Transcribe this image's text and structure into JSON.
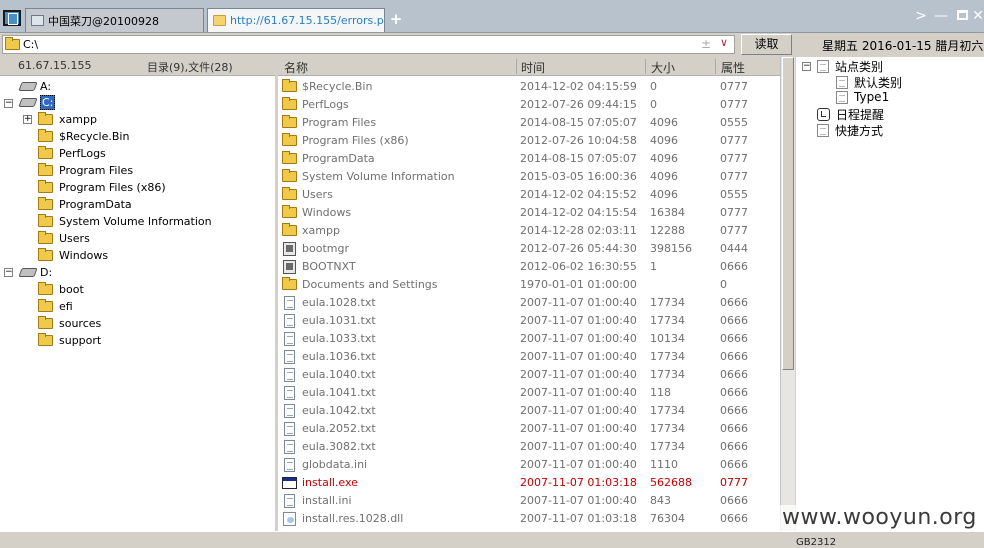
{
  "tabs": [
    {
      "label": "中国菜刀@20100928"
    },
    {
      "label": "http://61.67.15.155/errors.php"
    }
  ],
  "new_tab_label": "+",
  "address": {
    "path": "C:\\",
    "plus_minus": "±",
    "dropdown": "∨"
  },
  "read_button": "读取",
  "datetime": "星期五  2016-01-15  腊月初六",
  "left": {
    "ip": "61.67.15.155",
    "counts": "目录(9),文件(28)",
    "tree": [
      {
        "label": "A:"
      },
      {
        "label": "C:"
      },
      {
        "label": "xampp"
      },
      {
        "label": "$Recycle.Bin"
      },
      {
        "label": "PerfLogs"
      },
      {
        "label": "Program Files"
      },
      {
        "label": "Program Files (x86)"
      },
      {
        "label": "ProgramData"
      },
      {
        "label": "System Volume Information"
      },
      {
        "label": "Users"
      },
      {
        "label": "Windows"
      },
      {
        "label": "D:"
      },
      {
        "label": "boot"
      },
      {
        "label": "efi"
      },
      {
        "label": "sources"
      },
      {
        "label": "support"
      }
    ]
  },
  "list": {
    "columns": [
      "名称",
      "时间",
      "大小",
      "属性"
    ],
    "rows": [
      {
        "name": "$Recycle.Bin",
        "time": "2014-12-02 04:15:59",
        "size": "0",
        "attr": "0777",
        "type": "folder"
      },
      {
        "name": "PerfLogs",
        "time": "2012-07-26 09:44:15",
        "size": "0",
        "attr": "0777",
        "type": "folder"
      },
      {
        "name": "Program Files",
        "time": "2014-08-15 07:05:07",
        "size": "4096",
        "attr": "0555",
        "type": "folder"
      },
      {
        "name": "Program Files (x86)",
        "time": "2012-07-26 10:04:58",
        "size": "4096",
        "attr": "0777",
        "type": "folder"
      },
      {
        "name": "ProgramData",
        "time": "2014-08-15 07:05:07",
        "size": "4096",
        "attr": "0777",
        "type": "folder"
      },
      {
        "name": "System Volume Information",
        "time": "2015-03-05 16:00:36",
        "size": "4096",
        "attr": "0777",
        "type": "folder"
      },
      {
        "name": "Users",
        "time": "2014-12-02 04:15:52",
        "size": "4096",
        "attr": "0555",
        "type": "folder"
      },
      {
        "name": "Windows",
        "time": "2014-12-02 04:15:54",
        "size": "16384",
        "attr": "0777",
        "type": "folder"
      },
      {
        "name": "xampp",
        "time": "2014-12-28 02:03:11",
        "size": "12288",
        "attr": "0777",
        "type": "folder"
      },
      {
        "name": "bootmgr",
        "time": "2012-07-26 05:44:30",
        "size": "398156",
        "attr": "0444",
        "type": "system"
      },
      {
        "name": "BOOTNXT",
        "time": "2012-06-02 16:30:55",
        "size": "1",
        "attr": "0666",
        "type": "system"
      },
      {
        "name": "Documents and Settings",
        "time": "1970-01-01 01:00:00",
        "size": "",
        "attr": "0",
        "type": "folder"
      },
      {
        "name": "eula.1028.txt",
        "time": "2007-11-07 01:00:40",
        "size": "17734",
        "attr": "0666",
        "type": "text"
      },
      {
        "name": "eula.1031.txt",
        "time": "2007-11-07 01:00:40",
        "size": "17734",
        "attr": "0666",
        "type": "text"
      },
      {
        "name": "eula.1033.txt",
        "time": "2007-11-07 01:00:40",
        "size": "10134",
        "attr": "0666",
        "type": "text"
      },
      {
        "name": "eula.1036.txt",
        "time": "2007-11-07 01:00:40",
        "size": "17734",
        "attr": "0666",
        "type": "text"
      },
      {
        "name": "eula.1040.txt",
        "time": "2007-11-07 01:00:40",
        "size": "17734",
        "attr": "0666",
        "type": "text"
      },
      {
        "name": "eula.1041.txt",
        "time": "2007-11-07 01:00:40",
        "size": "118",
        "attr": "0666",
        "type": "text"
      },
      {
        "name": "eula.1042.txt",
        "time": "2007-11-07 01:00:40",
        "size": "17734",
        "attr": "0666",
        "type": "text"
      },
      {
        "name": "eula.2052.txt",
        "time": "2007-11-07 01:00:40",
        "size": "17734",
        "attr": "0666",
        "type": "text"
      },
      {
        "name": "eula.3082.txt",
        "time": "2007-11-07 01:00:40",
        "size": "17734",
        "attr": "0666",
        "type": "text"
      },
      {
        "name": "globdata.ini",
        "time": "2007-11-07 01:00:40",
        "size": "1110",
        "attr": "0666",
        "type": "text"
      },
      {
        "name": "install.exe",
        "time": "2007-11-07 01:03:18",
        "size": "562688",
        "attr": "0777",
        "type": "exe",
        "highlight": true
      },
      {
        "name": "install.ini",
        "time": "2007-11-07 01:00:40",
        "size": "843",
        "attr": "0666",
        "type": "text"
      },
      {
        "name": "install.res.1028.dll",
        "time": "2007-11-07 01:03:18",
        "size": "76304",
        "attr": "0666",
        "type": "dll"
      }
    ]
  },
  "right": {
    "items": [
      {
        "label": "站点类别"
      },
      {
        "label": "默认类别"
      },
      {
        "label": "Type1"
      },
      {
        "label": "日程提醒"
      },
      {
        "label": "快捷方式"
      }
    ]
  },
  "status": {
    "encoding": "GB2312"
  },
  "watermark": "www.wooyun.org",
  "colors": {
    "highlight_row": "#c00000",
    "selection": "#316ac5",
    "tab_active_text": "#2a7fc0"
  }
}
